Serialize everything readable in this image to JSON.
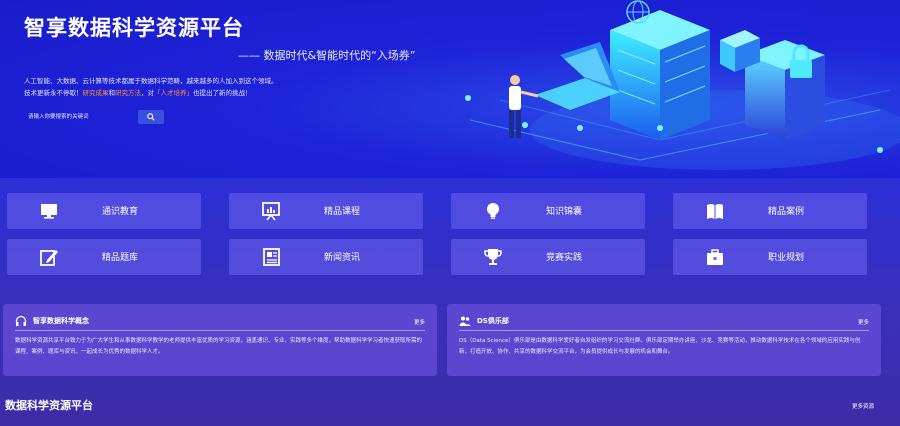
{
  "header": {
    "brand": "智享数据科学资源平台",
    "slogan": "—— 数据时代&智能时代的“入场券”",
    "intro_line1": "人工智能、大数据、云计算等技术都属于数据科学范畴，越来越多的人加入到这个领域。",
    "intro_line2_pre": "技术更新永不停歇！",
    "intro_hl1": "研究成果",
    "intro_mid1": "和",
    "intro_hl2": "研究方法",
    "intro_mid2": "，对",
    "intro_hl3": "「人才培养」",
    "intro_end": "也提出了新的挑战！",
    "search_placeholder": "请输入你要搜索的关键词",
    "search_icon": "search-icon"
  },
  "nav": [
    {
      "label": "通识教育",
      "icon": "monitor-icon"
    },
    {
      "label": "精品课程",
      "icon": "presentation-icon"
    },
    {
      "label": "知识锦囊",
      "icon": "lightbulb-icon"
    },
    {
      "label": "精品案例",
      "icon": "book-icon"
    },
    {
      "label": "精品题库",
      "icon": "edit-icon"
    },
    {
      "label": "新闻资讯",
      "icon": "newspaper-icon"
    },
    {
      "label": "竞赛实践",
      "icon": "trophy-icon"
    },
    {
      "label": "职业规划",
      "icon": "briefcase-icon"
    }
  ],
  "panels": [
    {
      "title": "智享数据科学概念",
      "more": "更多",
      "icon": "headphones-icon",
      "body": "数据科学资源共享平台致力于为广大学生和从事数据科学教学的老师提供丰富优质的学习资源，涵盖通识、专业、实践等多个维度，帮助数据科学学习者快速获取所需的课程、案例、题库与资讯，一起成长为优秀的数据科学人才。"
    },
    {
      "title": "DS俱乐部",
      "more": "更多",
      "icon": "users-icon",
      "body": "DS（Data Science）俱乐部是由数据科学爱好者自发组织的学习交流社群。俱乐部定期举办讲座、沙龙、竞赛等活动，推动数据科学技术在各个领域的应用实践与创新，打造开放、协作、共享的数据科学交流平台，为会员提供成长与发展的机会和舞台。"
    }
  ],
  "bottom": {
    "title": "数据科学资源平台",
    "more": "更多资源"
  },
  "colors": {
    "accent": "#ff8c3a",
    "card": "#6e64f0",
    "panel": "#785ae6",
    "bg": "#1a1fd0"
  }
}
